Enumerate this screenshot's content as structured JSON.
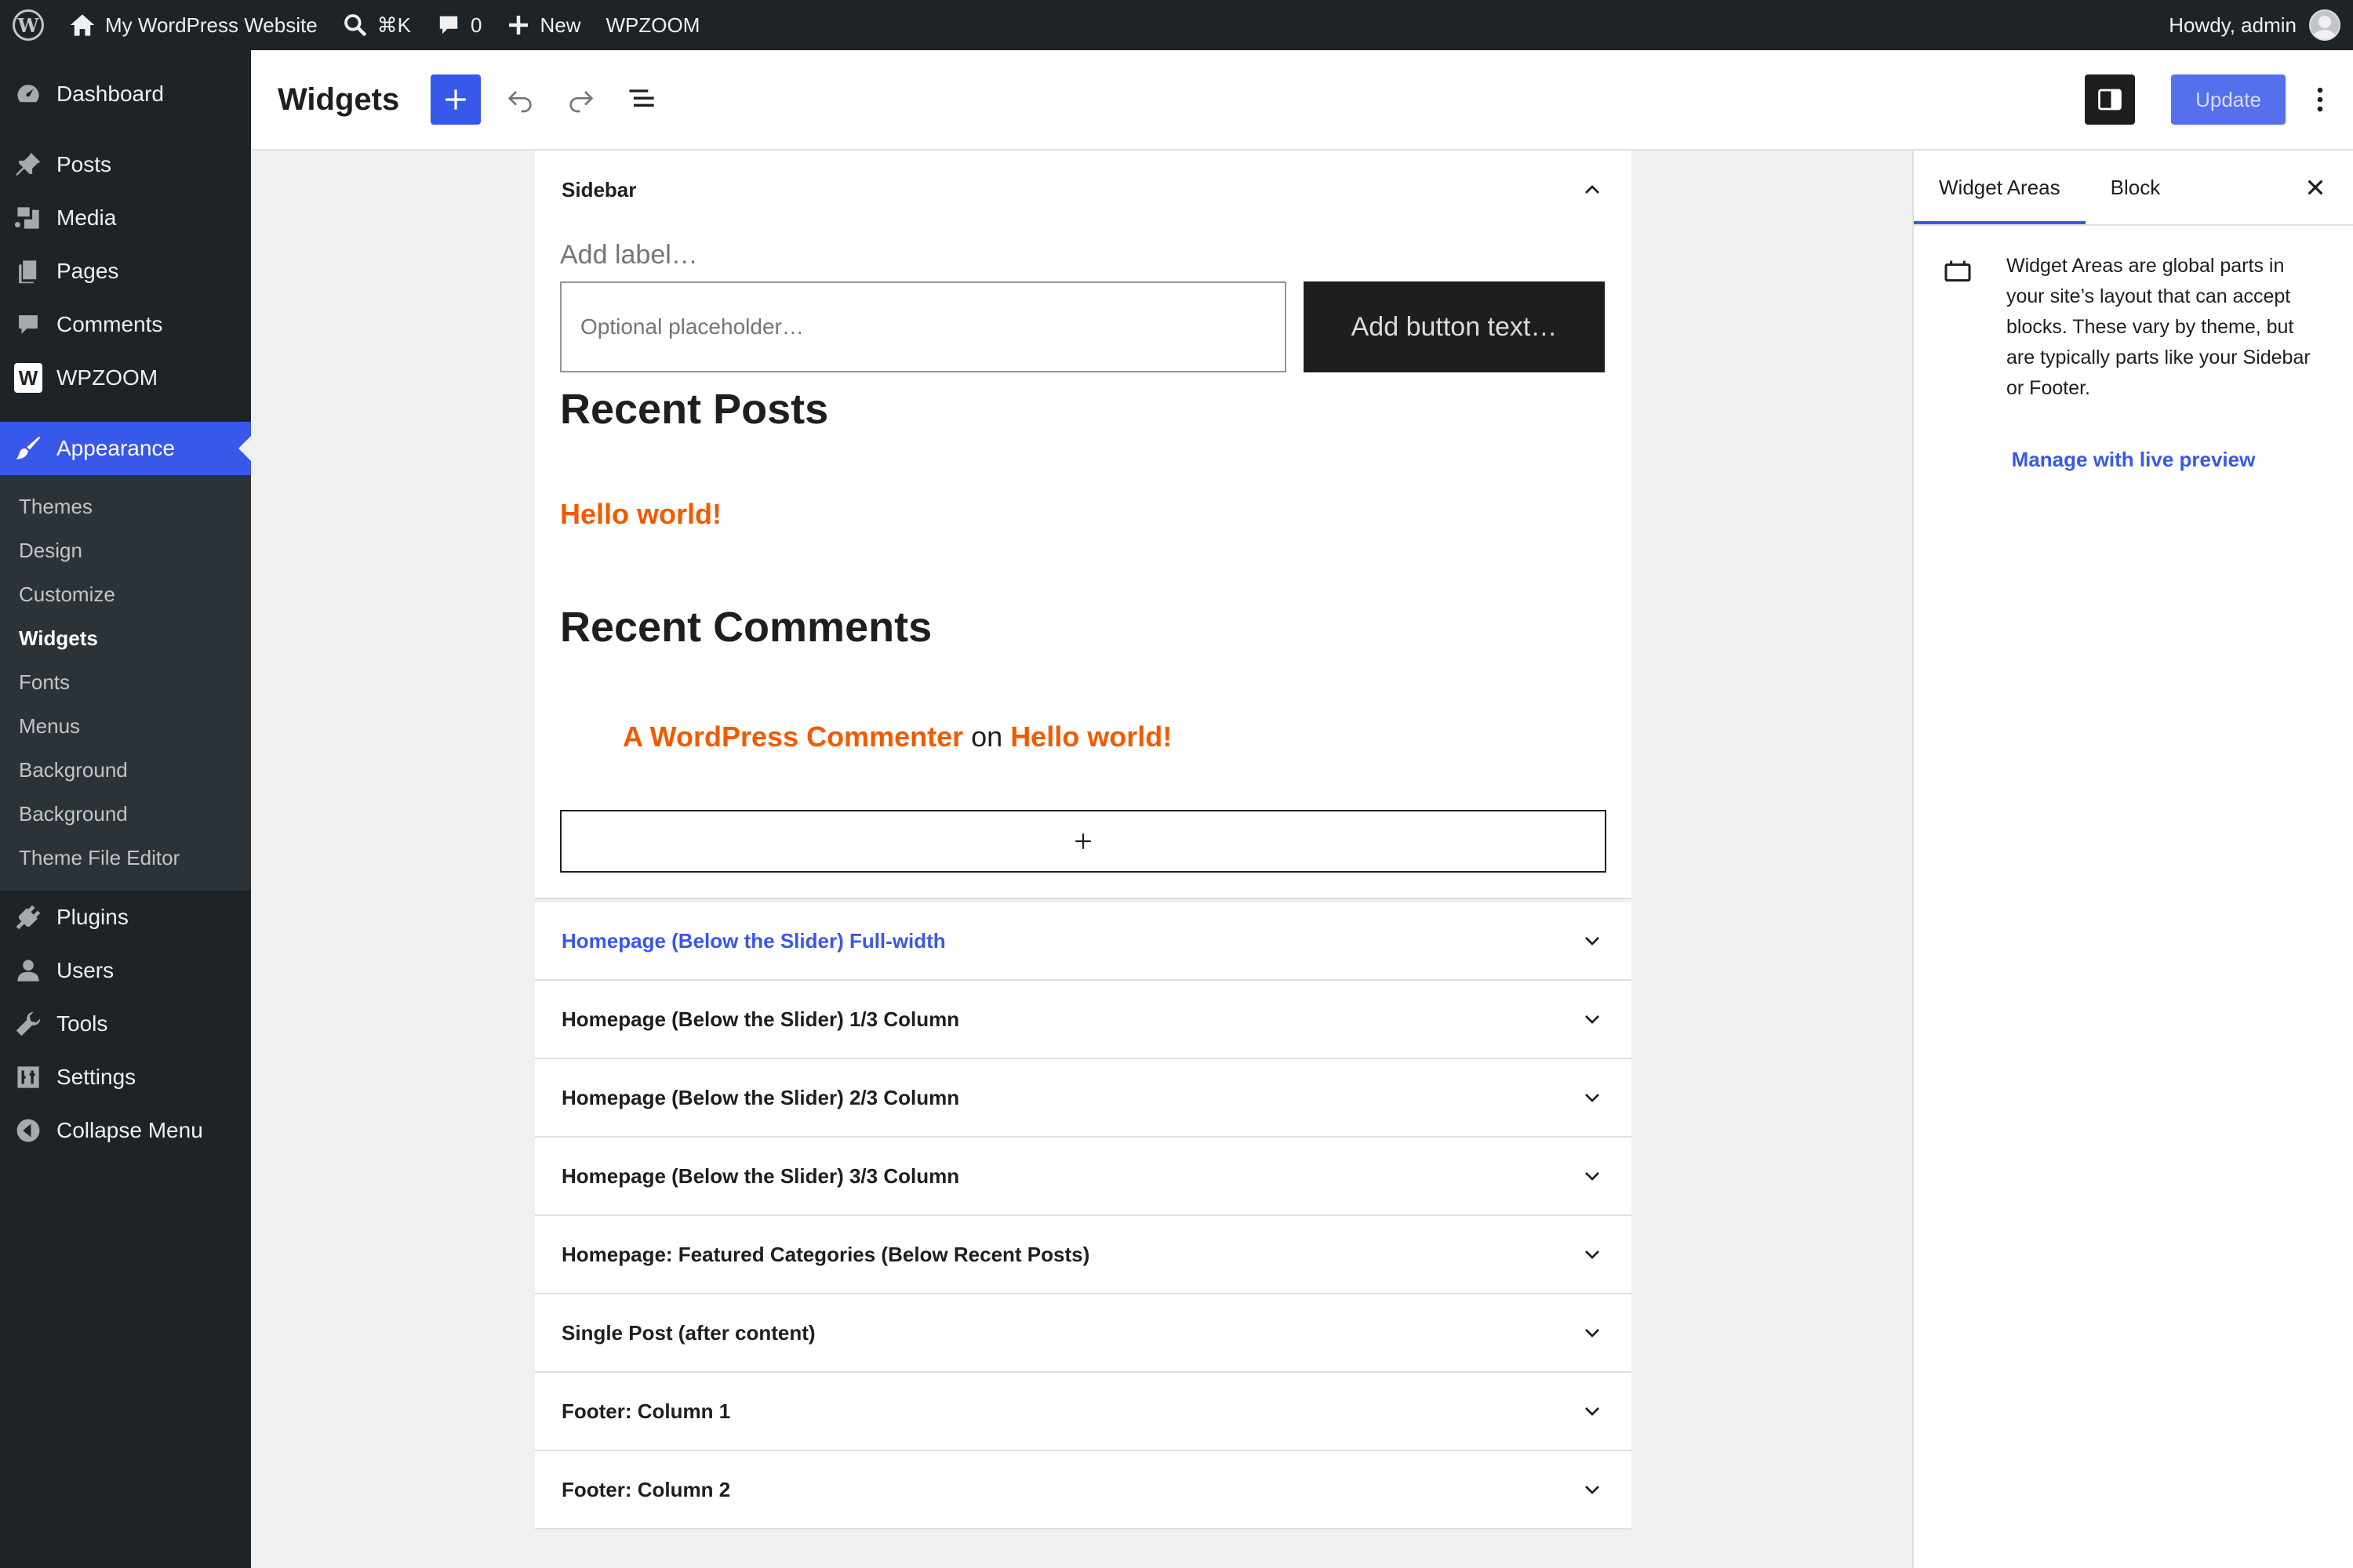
{
  "adminbar": {
    "site_name": "My WordPress Website",
    "search_shortcut": "⌘K",
    "comments_count": "0",
    "new_label": "New",
    "wpzoom_label": "WPZOOM",
    "howdy": "Howdy, admin"
  },
  "menu": {
    "dashboard": "Dashboard",
    "posts": "Posts",
    "media": "Media",
    "pages": "Pages",
    "comments": "Comments",
    "wpzoom": "WPZOOM",
    "appearance": "Appearance",
    "submenu": [
      "Themes",
      "Design",
      "Customize",
      "Widgets",
      "Fonts",
      "Menus",
      "Background",
      "Background",
      "Theme File Editor"
    ],
    "plugins": "Plugins",
    "users": "Users",
    "tools": "Tools",
    "settings": "Settings",
    "collapse": "Collapse Menu"
  },
  "header": {
    "title": "Widgets",
    "update_label": "Update"
  },
  "sidebar_area": {
    "title": "Sidebar",
    "search_label": "Add label…",
    "search_placeholder": "Optional placeholder…",
    "search_button": "Add button text…",
    "recent_posts_heading": "Recent Posts",
    "recent_post_link": "Hello world!",
    "recent_comments_heading": "Recent Comments",
    "comment_author": "A WordPress Commenter",
    "comment_on": "on",
    "comment_post": "Hello world!"
  },
  "areas": [
    "Homepage (Below the Slider) Full-width",
    "Homepage (Below the Slider) 1/3 Column",
    "Homepage (Below the Slider) 2/3 Column",
    "Homepage (Below the Slider) 3/3 Column",
    "Homepage: Featured Categories (Below Recent Posts)",
    "Single Post (after content)",
    "Footer: Column 1",
    "Footer: Column 2"
  ],
  "inspector": {
    "tab_widget_areas": "Widget Areas",
    "tab_block": "Block",
    "description": "Widget Areas are global parts in your site’s layout that can accept blocks. These vary by theme, but are typically parts like your Sidebar or Footer.",
    "manage_link": "Manage with live preview"
  },
  "colors": {
    "accent": "#3858e9",
    "link_orange": "#f05a00",
    "admin_dark": "#1d2327"
  }
}
